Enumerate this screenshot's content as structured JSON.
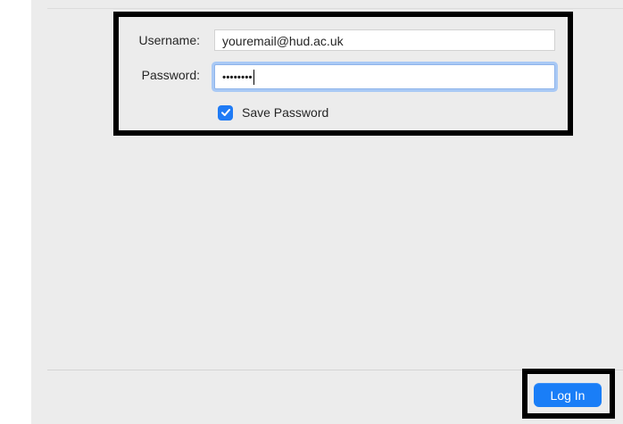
{
  "form": {
    "username_label": "Username:",
    "username_value": "youremail@hud.ac.uk",
    "password_label": "Password:",
    "password_value": "••••••••",
    "save_password_label": "Save Password",
    "save_password_checked": true
  },
  "footer": {
    "login_label": "Log In"
  },
  "colors": {
    "accent": "#1a7ef7",
    "panel_background": "#ececec",
    "highlight_border": "#000000"
  },
  "icons": {
    "checkbox": "checkmark-icon"
  }
}
